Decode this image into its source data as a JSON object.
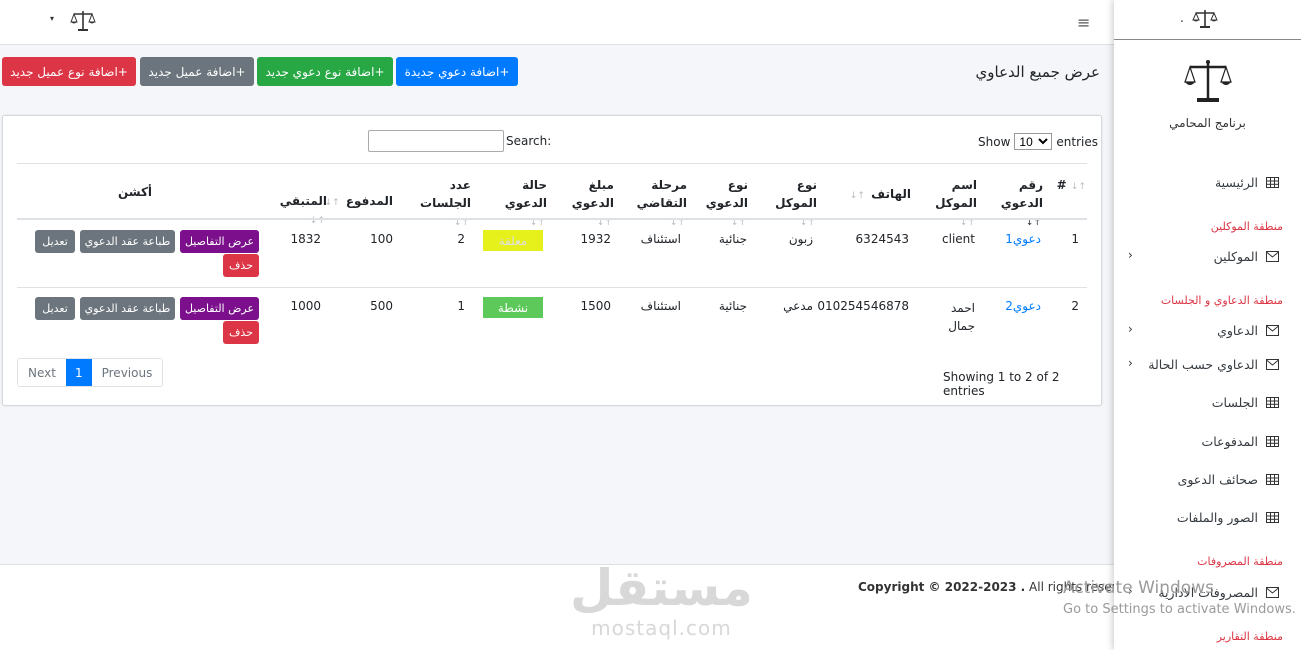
{
  "topbar": {
    "caret": "▾",
    "menu_icon": "hamburger-icon"
  },
  "sidebar": {
    "dot": ".",
    "brand_name": "برنامج المحامي",
    "items": [
      {
        "label": "الرئيسية",
        "icon": "grid-icon"
      },
      {
        "label": "الموكلين",
        "icon": "envelope-icon",
        "chevron": "‹"
      },
      {
        "label": "الدعاوي",
        "icon": "envelope-icon",
        "chevron": "‹"
      },
      {
        "label": "الدعاوي حسب الحالة",
        "icon": "envelope-icon",
        "chevron": "‹"
      },
      {
        "label": "الجلسات",
        "icon": "grid-icon"
      },
      {
        "label": "المدفوعات",
        "icon": "grid-icon"
      },
      {
        "label": "صحائف الدعوى",
        "icon": "grid-icon"
      },
      {
        "label": "الصور والملفات",
        "icon": "grid-icon"
      },
      {
        "label": "المصروفات الادارية",
        "icon": "envelope-icon",
        "chevron": "‹"
      }
    ],
    "headers": [
      "منطقة الموكلين",
      "منطقة الدعاوي و الجلسات",
      "منطقة المصروفات",
      "منطقة التقارير"
    ]
  },
  "page": {
    "title": "عرض جميع الدعاوي",
    "buttons": {
      "add_client_type": "+اضافة نوع عميل جديد",
      "add_client": "+اضافة عميل جديد",
      "add_case_type": "+اضافة نوع دعوي جديد",
      "add_case": "+اضافة دعوي جديدة"
    }
  },
  "table": {
    "show_label": "Show",
    "entries_label": "entries",
    "page_size": "10",
    "search_label": "Search:",
    "columns": {
      "num": "#",
      "case_no": "رقم الدعوي",
      "client_name": "اسم الموكل",
      "phone": "الهاتف",
      "client_type": "نوع الموكل",
      "case_type": "نوع الدعوي",
      "stage": "مرحلة التقاضي",
      "amount": "مبلغ الدعوي",
      "status": "حالة الدعوي",
      "sessions": "عدد الجلسات",
      "paid": "المدفوع",
      "remaining": "المتبقي",
      "action": "أكشن"
    },
    "sort_icon": "↑↓",
    "rows": [
      {
        "num": "1",
        "case_no": "دعوي1",
        "client_name": "client",
        "phone": "6324543",
        "client_type": "زبون",
        "case_type": "جنائية",
        "stage": "استئناف",
        "amount": "1932",
        "status": "معلقة",
        "sessions": "2",
        "paid": "100",
        "remaining": "1832"
      },
      {
        "num": "2",
        "case_no": "دعوي2",
        "client_name": "احمد جمال",
        "phone": "010254546878",
        "client_type": "مدعي",
        "case_type": "جنائية",
        "stage": "استئناف",
        "amount": "1500",
        "status": "نشطة",
        "sessions": "1",
        "paid": "500",
        "remaining": "1000"
      }
    ],
    "actions": {
      "details": "عرض التفاصيل",
      "print": "طباعة عقد الدعوي",
      "edit": "تعديل",
      "delete": "حذف"
    },
    "info": "Showing 1 to 2 of 2 entries",
    "pager": {
      "next": "Next",
      "current": "1",
      "previous": "Previous"
    }
  },
  "footer": {
    "copyright": "Copyright © 2022-2023 .",
    "rights": " All rights reserved."
  },
  "watermark": {
    "arabic": "مستقل",
    "latin": "mostaql.com"
  },
  "activation": {
    "title": "Activate Windows",
    "subtitle": "Go to Settings to activate Windows."
  },
  "colors": {
    "primary": "#007bff",
    "danger": "#dc3545",
    "success": "#28a745",
    "secondary": "#6c757d",
    "purple": "#7b0f8c",
    "pending": "#e6f01a",
    "active": "#5cc95a"
  }
}
